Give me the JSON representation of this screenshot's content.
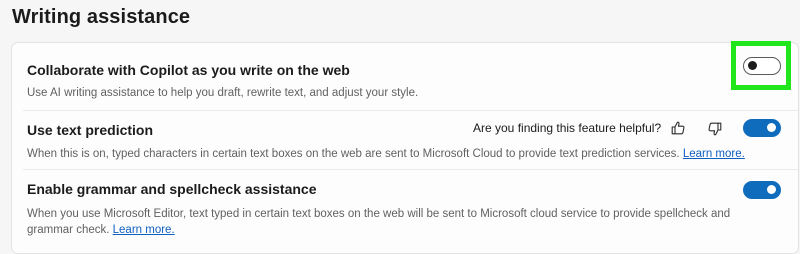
{
  "section": {
    "title": "Writing assistance"
  },
  "settings": [
    {
      "title": "Collaborate with Copilot as you write on the web",
      "description": "Use AI writing assistance to help you draft, rewrite text, and adjust your style.",
      "enabled": false
    },
    {
      "title": "Use text prediction",
      "description": "When this is on, typed characters in certain text boxes on the web are sent to Microsoft Cloud to provide text prediction services.",
      "link": "Learn more.",
      "feedback_question": "Are you finding this feature helpful?",
      "enabled": true
    },
    {
      "title": "Enable grammar and spellcheck assistance",
      "description": "When you use Microsoft Editor, text typed in certain text boxes on the web will be sent to Microsoft cloud service to provide spellcheck and grammar check.",
      "link": "Learn more.",
      "enabled": true
    }
  ],
  "icons": {
    "thumbs_up": "thumbs-up-icon",
    "thumbs_down": "thumbs-down-icon"
  },
  "colors": {
    "accent": "#0f6cbd",
    "highlight": "#22e61c",
    "link": "#0f5fc2"
  }
}
